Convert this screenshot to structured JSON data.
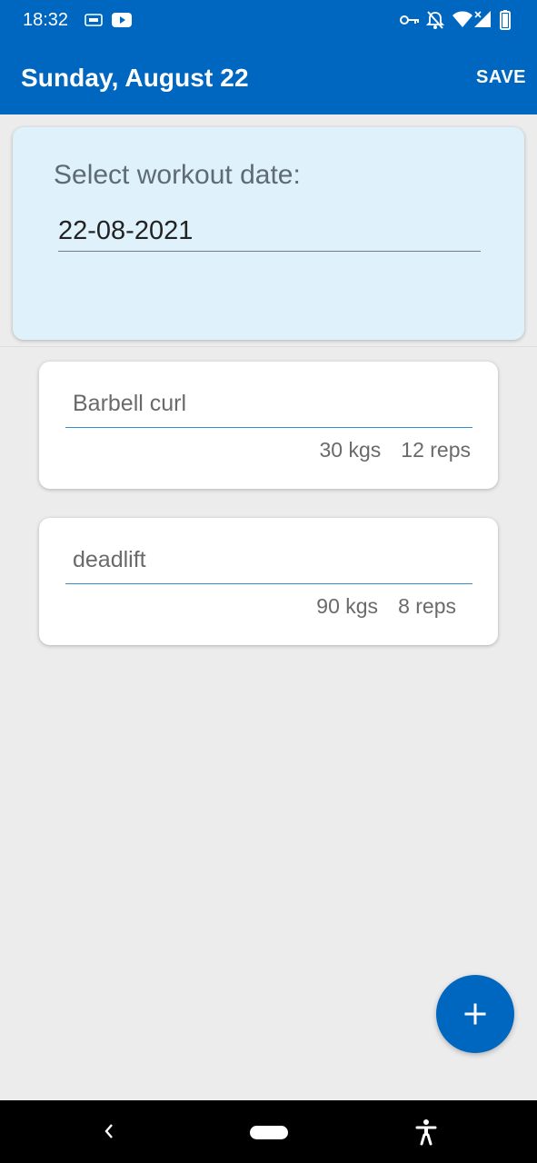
{
  "status_bar": {
    "time": "18:32",
    "icons": [
      "cast-icon",
      "youtube-icon",
      "vpn-key-icon",
      "notifications-off-icon",
      "wifi-icon",
      "signal-icon",
      "battery-icon"
    ]
  },
  "app_bar": {
    "title": "Sunday, August 22",
    "save_label": "SAVE"
  },
  "date_card": {
    "label": "Select workout date:",
    "value": "22-08-2021"
  },
  "exercises": [
    {
      "name": "Barbell curl",
      "weight": "30 kgs",
      "reps": "12 reps"
    },
    {
      "name": "deadlift",
      "weight": "90 kgs",
      "reps": "8 reps"
    }
  ],
  "fab": {
    "icon": "plus-icon"
  },
  "nav_bar": {
    "icons": [
      "back-icon",
      "home-pill-icon",
      "accessibility-icon"
    ]
  },
  "colors": {
    "primary": "#0067c0",
    "date_card_bg": "#dff1fb",
    "background": "#ececec",
    "field_underline": "#2f8fd0"
  }
}
